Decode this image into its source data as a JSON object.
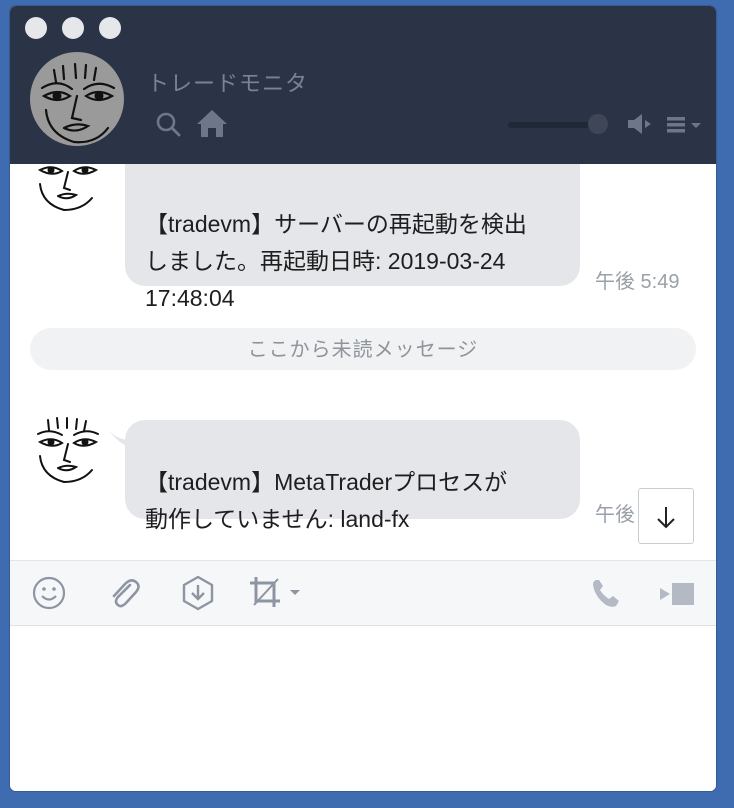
{
  "window": {
    "title": "トレードモニタ"
  },
  "header": {
    "icons": [
      "search-icon",
      "home-icon",
      "volume-slider",
      "speaker-icon",
      "menu-icon"
    ],
    "volume_level": 0.85
  },
  "messages": [
    {
      "text": "【tradevm】サーバーの再起動を検出\nしました。再起動日時: 2019-03-24\n17:48:04",
      "time": "午後 5:49"
    },
    {
      "text": "【tradevm】MetaTraderプロセスが\n動作していません: land-fx",
      "time": "午後 6:10"
    }
  ],
  "unread_divider": "ここから未読メッセージ",
  "toolbar": {
    "icons": [
      "emoji-icon",
      "attachment-icon",
      "keep-icon",
      "screenshot-icon",
      "call-icon",
      "video-call-icon"
    ]
  },
  "colors": {
    "header_bg": "#2b3446",
    "bubble_bg": "#e4e6ea",
    "desktop_bg": "#3f6bb0"
  }
}
